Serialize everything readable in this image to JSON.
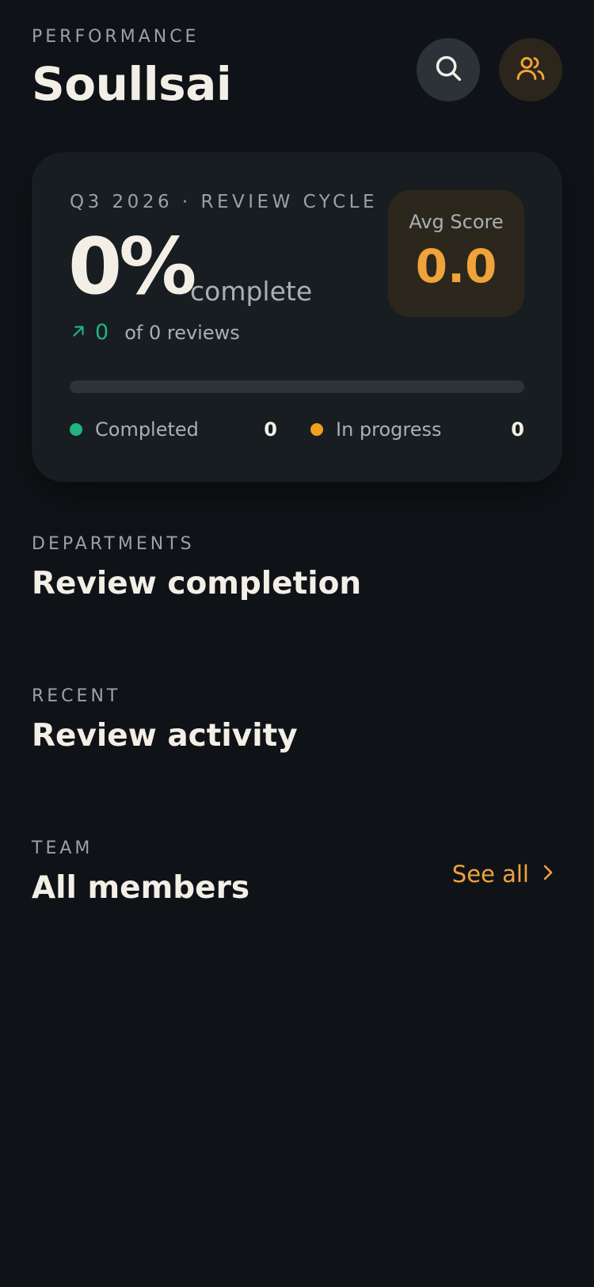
{
  "header": {
    "eyebrow": "PERFORMANCE",
    "title": "Soullsai",
    "search_icon": "search-icon",
    "team_icon": "users-icon"
  },
  "hero": {
    "cycle_label": "Q3 2026 · REVIEW CYCLE",
    "percent": "0%",
    "percent_suffix": "complete",
    "trend_icon": "arrow-up-right-icon",
    "trend_value": "0",
    "trend_text": "of 0 reviews",
    "avg_label": "Avg Score",
    "avg_value": "0.0",
    "progress_fraction": 0,
    "legend": [
      {
        "label": "Completed",
        "count": "0",
        "color": "#22b381"
      },
      {
        "label": "In progress",
        "count": "0",
        "color": "#f0a020"
      }
    ]
  },
  "sections": [
    {
      "eyebrow": "DEPARTMENTS",
      "title": "Review completion"
    },
    {
      "eyebrow": "RECENT",
      "title": "Review activity"
    },
    {
      "eyebrow": "TEAM",
      "title": "All members",
      "action": "See all"
    }
  ],
  "colors": {
    "background": "#0f1317",
    "card": "#171d21",
    "accent": "#f0a33a",
    "success": "#22b381"
  }
}
